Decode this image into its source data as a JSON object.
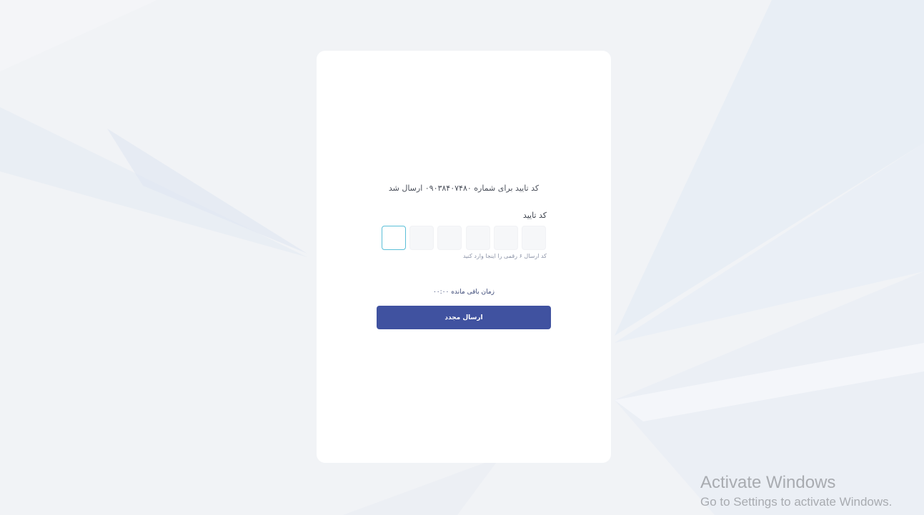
{
  "verification": {
    "sent_message": "کد تایید برای شماره ۰۹۰۳۸۴۰۷۴۸۰ ارسال شد",
    "code_label": "کد تایید",
    "otp_digits": [
      "",
      "",
      "",
      "",
      "",
      ""
    ],
    "otp_hint": "کد ارسال ۶ رقمی را اینجا وارد کنید",
    "timer_text": "زمان باقی مانده ۰۰:۰۰",
    "resend_label": "ارسال مجدد"
  },
  "colors": {
    "button_bg": "#4052a0",
    "active_box_border": "#5bbfd8",
    "page_bg": "#f1f3f6"
  },
  "watermark": {
    "title": "Activate Windows",
    "subtitle": "Go to Settings to activate Windows."
  }
}
